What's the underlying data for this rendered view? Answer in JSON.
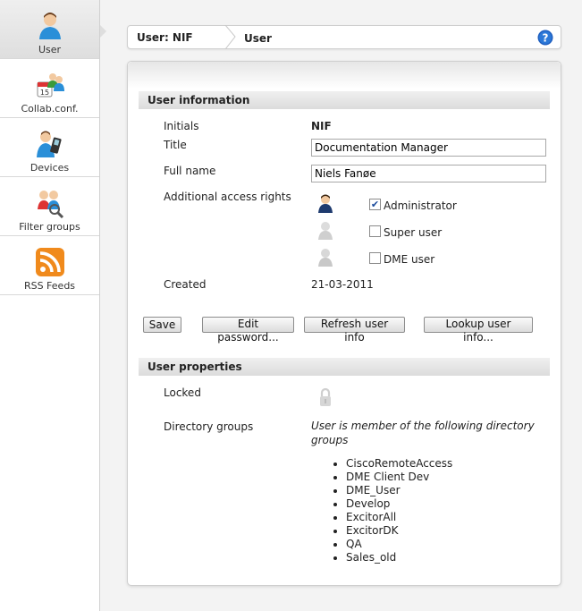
{
  "sidebar": {
    "items": [
      {
        "label": "User",
        "icon": "user-icon",
        "active": true
      },
      {
        "label": "Collab.conf.",
        "icon": "collab-conf-icon"
      },
      {
        "label": "Devices",
        "icon": "devices-icon"
      },
      {
        "label": "Filter groups",
        "icon": "filter-groups-icon"
      },
      {
        "label": "RSS Feeds",
        "icon": "rss-icon"
      }
    ]
  },
  "breadcrumb": {
    "first": "User: NIF",
    "second": "User",
    "help_icon": "help-icon"
  },
  "user_info": {
    "header": "User information",
    "initials_label": "Initials",
    "initials_value": "NIF",
    "title_label": "Title",
    "title_value": "Documentation Manager",
    "fullname_label": "Full name",
    "fullname_value": "Niels Fanøe",
    "access_label": "Additional access rights",
    "rights": [
      {
        "label": "Administrator",
        "checked": true,
        "icon": "administrator-icon"
      },
      {
        "label": "Super user",
        "checked": false,
        "icon": "super-user-icon"
      },
      {
        "label": "DME user",
        "checked": false,
        "icon": "dme-user-icon"
      }
    ],
    "created_label": "Created",
    "created_value": "21-03-2011"
  },
  "buttons": {
    "save": "Save",
    "edit_password": "Edit password...",
    "refresh": "Refresh user info",
    "lookup": "Lookup user info..."
  },
  "user_props": {
    "header": "User properties",
    "locked_label": "Locked",
    "locked_icon": "lock-icon",
    "dirgroups_label": "Directory groups",
    "dirgroups_intro": "User is member of the following directory groups",
    "groups": [
      "CiscoRemoteAccess",
      "DME Client Dev",
      "DME_User",
      "Develop",
      "ExcitorAll",
      "ExcitorDK",
      "QA",
      "Sales_old"
    ]
  },
  "colors": {
    "accent_blue": "#1f5fbf",
    "rss_orange": "#f08a1c",
    "checkbox_check": "#1a4b9c"
  }
}
